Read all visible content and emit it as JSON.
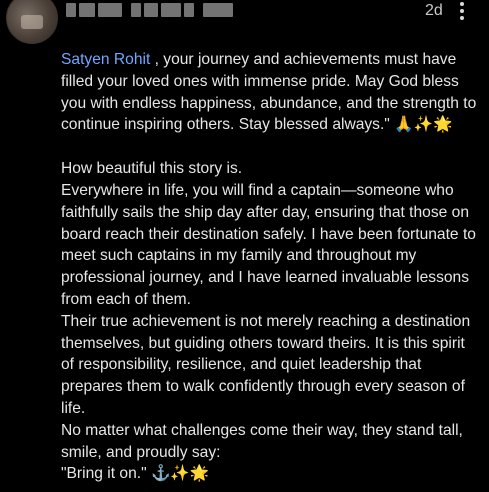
{
  "comment": {
    "timestamp": "2d",
    "mention": "Satyen Rohit",
    "first_para_rest": " , your journey and achievements must have filled your loved ones with immense pride. May God bless you with endless happiness, abundance, and the strength to continue inspiring others. Stay blessed always.\" 🙏✨🌟",
    "lines": [
      "How beautiful this story is.",
      "Everywhere in life, you will find a captain—someone who faithfully sails the ship day after day, ensuring that those on board reach their destination safely. I have been fortunate to meet such captains in my family and throughout my professional journey, and I have learned invaluable lessons from each of them.",
      "Their true achievement is not merely reaching a destination themselves, but guiding others toward theirs. It is this spirit of responsibility, resilience, and quiet leadership that prepares them to walk confidently through every season of life.",
      "No matter what challenges come their way, they stand tall, smile, and proudly say:",
      "\"Bring it on.\" ⚓✨🌟"
    ],
    "mention_color": "#6ea8ff"
  }
}
